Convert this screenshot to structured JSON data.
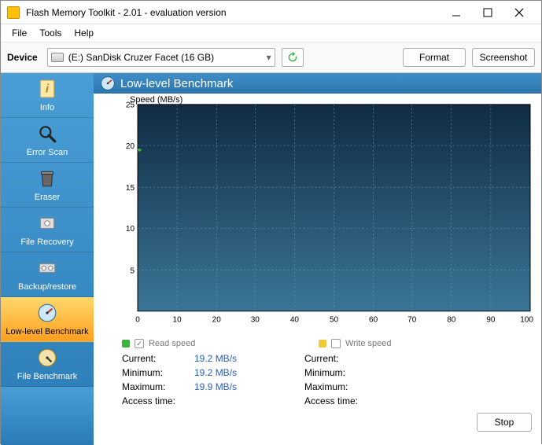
{
  "window": {
    "title": "Flash Memory Toolkit - 2.01 - evaluation version"
  },
  "menu": {
    "file": "File",
    "tools": "Tools",
    "help": "Help"
  },
  "device": {
    "label": "Device",
    "selected": "(E:) SanDisk Cruzer Facet (16 GB)",
    "format_btn": "Format",
    "screenshot_btn": "Screenshot"
  },
  "sidebar": {
    "items": [
      {
        "label": "Info"
      },
      {
        "label": "Error Scan"
      },
      {
        "label": "Eraser"
      },
      {
        "label": "File Recovery"
      },
      {
        "label": "Backup/restore"
      },
      {
        "label": "Low-level Benchmark"
      },
      {
        "label": "File Benchmark"
      }
    ]
  },
  "panel": {
    "title": "Low-level Benchmark",
    "speed_label": "Speed (MB/s)",
    "legend_read": "Read speed",
    "legend_write": "Write speed",
    "labels": {
      "current": "Current:",
      "minimum": "Minimum:",
      "maximum": "Maximum:",
      "access": "Access time:"
    },
    "read_stats": {
      "current": "19.2 MB/s",
      "minimum": "19.2 MB/s",
      "maximum": "19.9 MB/s",
      "access": ""
    },
    "write_stats": {
      "current": "",
      "minimum": "",
      "maximum": "",
      "access": ""
    },
    "stop_btn": "Stop"
  },
  "chart_data": {
    "type": "line",
    "xlabel": "",
    "ylabel": "Speed (MB/s)",
    "xlim": [
      0,
      100
    ],
    "ylim": [
      0,
      25
    ],
    "x_ticks": [
      0,
      10,
      20,
      30,
      40,
      50,
      60,
      70,
      80,
      90,
      100
    ],
    "x_tick_labels": [
      "0",
      "10",
      "20",
      "30",
      "40",
      "50",
      "60",
      "70",
      "80",
      "90",
      "100%"
    ],
    "y_ticks": [
      5,
      10,
      15,
      20,
      25
    ],
    "series": [
      {
        "name": "Read speed",
        "color": "#3bb23b",
        "x": [
          0
        ],
        "y": [
          19.5
        ]
      },
      {
        "name": "Write speed",
        "color": "#f0c93a",
        "x": [],
        "y": []
      }
    ]
  }
}
